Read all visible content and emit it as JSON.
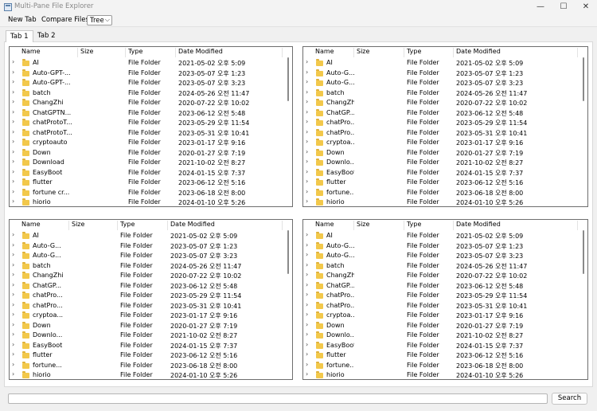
{
  "window": {
    "title": "Multi-Pane File Explorer",
    "minimize_glyph": "—",
    "maximize_glyph": "☐",
    "close_glyph": "✕"
  },
  "menu": {
    "new_tab": "New Tab",
    "compare_files": "Compare Files",
    "view_mode": "Tree",
    "view_mode_arrow": "⌵"
  },
  "tabs": [
    {
      "label": "Tab 1",
      "active": true
    },
    {
      "label": "Tab 2",
      "active": false
    }
  ],
  "columns": [
    "Name",
    "Size",
    "Type",
    "Date Modified"
  ],
  "panes": [
    {
      "rows": [
        {
          "name": "AI",
          "size": "",
          "type": "File Folder",
          "date": "2021-05-02 오후 5:09"
        },
        {
          "name": "Auto-GPT-...",
          "size": "",
          "type": "File Folder",
          "date": "2023-05-07 오후 1:23"
        },
        {
          "name": "Auto-GPT-...",
          "size": "",
          "type": "File Folder",
          "date": "2023-05-07 오후 3:23"
        },
        {
          "name": "batch",
          "size": "",
          "type": "File Folder",
          "date": "2024-05-26 오전 11:47"
        },
        {
          "name": "ChangZhi",
          "size": "",
          "type": "File Folder",
          "date": "2020-07-22 오후 10:02"
        },
        {
          "name": "ChatGPTN...",
          "size": "",
          "type": "File Folder",
          "date": "2023-06-12 오전 5:48"
        },
        {
          "name": "chatProtoT...",
          "size": "",
          "type": "File Folder",
          "date": "2023-05-29 오후 11:54"
        },
        {
          "name": "chatProtoT...",
          "size": "",
          "type": "File Folder",
          "date": "2023-05-31 오후 10:41"
        },
        {
          "name": "cryptoauto",
          "size": "",
          "type": "File Folder",
          "date": "2023-01-17 오후 9:16"
        },
        {
          "name": "Down",
          "size": "",
          "type": "File Folder",
          "date": "2020-01-27 오후 7:19"
        },
        {
          "name": "Download",
          "size": "",
          "type": "File Folder",
          "date": "2021-10-02 오전 8:27"
        },
        {
          "name": "EasyBoot",
          "size": "",
          "type": "File Folder",
          "date": "2024-01-15 오후 7:37"
        },
        {
          "name": "flutter",
          "size": "",
          "type": "File Folder",
          "date": "2023-06-12 오전 5:16"
        },
        {
          "name": "fortune cr...",
          "size": "",
          "type": "File Folder",
          "date": "2023-06-18 오전 8:00"
        },
        {
          "name": "hiorio",
          "size": "",
          "type": "File Folder",
          "date": "2024-01-10 오후 5:26"
        }
      ]
    },
    {
      "rows": [
        {
          "name": "AI",
          "size": "",
          "type": "File Folder",
          "date": "2021-05-02 오후 5:09"
        },
        {
          "name": "Auto-G...",
          "size": "",
          "type": "File Folder",
          "date": "2023-05-07 오후 1:23"
        },
        {
          "name": "Auto-G...",
          "size": "",
          "type": "File Folder",
          "date": "2023-05-07 오후 3:23"
        },
        {
          "name": "batch",
          "size": "",
          "type": "File Folder",
          "date": "2024-05-26 오전 11:47"
        },
        {
          "name": "ChangZhi",
          "size": "",
          "type": "File Folder",
          "date": "2020-07-22 오후 10:02"
        },
        {
          "name": "ChatGP...",
          "size": "",
          "type": "File Folder",
          "date": "2023-06-12 오전 5:48"
        },
        {
          "name": "chatPro...",
          "size": "",
          "type": "File Folder",
          "date": "2023-05-29 오후 11:54"
        },
        {
          "name": "chatPro...",
          "size": "",
          "type": "File Folder",
          "date": "2023-05-31 오후 10:41"
        },
        {
          "name": "cryptoa...",
          "size": "",
          "type": "File Folder",
          "date": "2023-01-17 오후 9:16"
        },
        {
          "name": "Down",
          "size": "",
          "type": "File Folder",
          "date": "2020-01-27 오후 7:19"
        },
        {
          "name": "Downlo...",
          "size": "",
          "type": "File Folder",
          "date": "2021-10-02 오전 8:27"
        },
        {
          "name": "EasyBoot",
          "size": "",
          "type": "File Folder",
          "date": "2024-01-15 오후 7:37"
        },
        {
          "name": "flutter",
          "size": "",
          "type": "File Folder",
          "date": "2023-06-12 오전 5:16"
        },
        {
          "name": "fortune...",
          "size": "",
          "type": "File Folder",
          "date": "2023-06-18 오전 8:00"
        },
        {
          "name": "hiorio",
          "size": "",
          "type": "File Folder",
          "date": "2024-01-10 오후 5:26"
        }
      ]
    },
    {
      "rows": [
        {
          "name": "AI",
          "size": "",
          "type": "File Folder",
          "date": "2021-05-02 오후 5:09"
        },
        {
          "name": "Auto-G...",
          "size": "",
          "type": "File Folder",
          "date": "2023-05-07 오후 1:23"
        },
        {
          "name": "Auto-G...",
          "size": "",
          "type": "File Folder",
          "date": "2023-05-07 오후 3:23"
        },
        {
          "name": "batch",
          "size": "",
          "type": "File Folder",
          "date": "2024-05-26 오전 11:47"
        },
        {
          "name": "ChangZhi",
          "size": "",
          "type": "File Folder",
          "date": "2020-07-22 오후 10:02"
        },
        {
          "name": "ChatGP...",
          "size": "",
          "type": "File Folder",
          "date": "2023-06-12 오전 5:48"
        },
        {
          "name": "chatPro...",
          "size": "",
          "type": "File Folder",
          "date": "2023-05-29 오후 11:54"
        },
        {
          "name": "chatPro...",
          "size": "",
          "type": "File Folder",
          "date": "2023-05-31 오후 10:41"
        },
        {
          "name": "cryptoa...",
          "size": "",
          "type": "File Folder",
          "date": "2023-01-17 오후 9:16"
        },
        {
          "name": "Down",
          "size": "",
          "type": "File Folder",
          "date": "2020-01-27 오후 7:19"
        },
        {
          "name": "Downlo...",
          "size": "",
          "type": "File Folder",
          "date": "2021-10-02 오전 8:27"
        },
        {
          "name": "EasyBoot",
          "size": "",
          "type": "File Folder",
          "date": "2024-01-15 오후 7:37"
        },
        {
          "name": "flutter",
          "size": "",
          "type": "File Folder",
          "date": "2023-06-12 오전 5:16"
        },
        {
          "name": "fortune...",
          "size": "",
          "type": "File Folder",
          "date": "2023-06-18 오전 8:00"
        },
        {
          "name": "hiorio",
          "size": "",
          "type": "File Folder",
          "date": "2024-01-10 오후 5:26"
        }
      ]
    },
    {
      "rows": [
        {
          "name": "AI",
          "size": "",
          "type": "File Folder",
          "date": "2021-05-02 오후 5:09"
        },
        {
          "name": "Auto-G...",
          "size": "",
          "type": "File Folder",
          "date": "2023-05-07 오후 1:23"
        },
        {
          "name": "Auto-G...",
          "size": "",
          "type": "File Folder",
          "date": "2023-05-07 오후 3:23"
        },
        {
          "name": "batch",
          "size": "",
          "type": "File Folder",
          "date": "2024-05-26 오전 11:47"
        },
        {
          "name": "ChangZhi",
          "size": "",
          "type": "File Folder",
          "date": "2020-07-22 오후 10:02"
        },
        {
          "name": "ChatGP...",
          "size": "",
          "type": "File Folder",
          "date": "2023-06-12 오전 5:48"
        },
        {
          "name": "chatPro...",
          "size": "",
          "type": "File Folder",
          "date": "2023-05-29 오후 11:54"
        },
        {
          "name": "chatPro...",
          "size": "",
          "type": "File Folder",
          "date": "2023-05-31 오후 10:41"
        },
        {
          "name": "cryptoa...",
          "size": "",
          "type": "File Folder",
          "date": "2023-01-17 오후 9:16"
        },
        {
          "name": "Down",
          "size": "",
          "type": "File Folder",
          "date": "2020-01-27 오후 7:19"
        },
        {
          "name": "Downlo...",
          "size": "",
          "type": "File Folder",
          "date": "2021-10-02 오전 8:27"
        },
        {
          "name": "EasyBoot",
          "size": "",
          "type": "File Folder",
          "date": "2024-01-15 오후 7:37"
        },
        {
          "name": "flutter",
          "size": "",
          "type": "File Folder",
          "date": "2023-06-12 오전 5:16"
        },
        {
          "name": "fortune...",
          "size": "",
          "type": "File Folder",
          "date": "2023-06-18 오전 8:00"
        },
        {
          "name": "hiorio",
          "size": "",
          "type": "File Folder",
          "date": "2024-01-10 오후 5:26"
        }
      ]
    }
  ],
  "expander_glyph": "›",
  "search": {
    "value": "",
    "button_label": "Search"
  }
}
